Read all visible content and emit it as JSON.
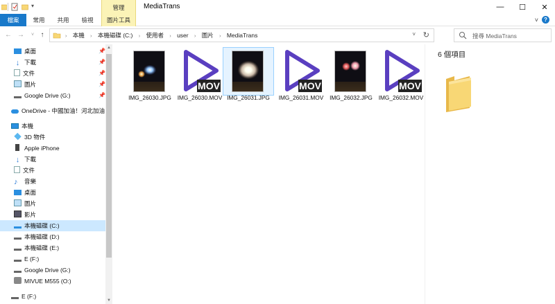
{
  "titlebar": {
    "title": "MediaTrans",
    "context_group": "管理",
    "minimize": "—",
    "maximize": "☐",
    "close": "✕"
  },
  "ribbon": {
    "tabs": [
      "檔案",
      "常用",
      "共用",
      "檢視"
    ],
    "context_tab": "圖片工具",
    "toggle": "˅",
    "help": "?"
  },
  "address": {
    "crumbs": [
      "本機",
      "本機磁碟 (C:)",
      "使用者",
      "user",
      "圖片",
      "MediaTrans"
    ],
    "search_placeholder": "搜尋 MediaTrans"
  },
  "nav": {
    "quick_access": [
      {
        "label": "桌面",
        "icon": "desktop-icon",
        "pinned": true
      },
      {
        "label": "下載",
        "icon": "download-icon",
        "pinned": true
      },
      {
        "label": "文件",
        "icon": "document-icon",
        "pinned": true
      },
      {
        "label": "圖片",
        "icon": "pictures-icon",
        "pinned": true
      },
      {
        "label": "Google Drive (G:)",
        "icon": "drive-icon",
        "pinned": true
      }
    ],
    "onedrive": "OneDrive - 中國加油！河北加油！",
    "this_pc": "本機",
    "pc_items": [
      {
        "label": "3D 物件",
        "icon": "cube-icon"
      },
      {
        "label": "Apple iPhone",
        "icon": "phone-icon"
      },
      {
        "label": "下載",
        "icon": "download-icon"
      },
      {
        "label": "文件",
        "icon": "document-icon"
      },
      {
        "label": "音樂",
        "icon": "music-icon"
      },
      {
        "label": "桌面",
        "icon": "desktop-icon"
      },
      {
        "label": "圖片",
        "icon": "pictures-icon"
      },
      {
        "label": "影片",
        "icon": "video-icon"
      },
      {
        "label": "本機磁碟 (C:)",
        "icon": "drive-icon",
        "selected": true
      },
      {
        "label": "本機磁碟 (D:)",
        "icon": "drive-icon"
      },
      {
        "label": "本機磁碟 (E:)",
        "icon": "drive-icon"
      },
      {
        "label": "E (F:)",
        "icon": "drive-icon"
      },
      {
        "label": "Google Drive (G:)",
        "icon": "drive-icon"
      },
      {
        "label": "MIVUE M555 (O:)",
        "icon": "camera-icon"
      }
    ],
    "bottom_item": "E (F:)"
  },
  "files": [
    {
      "name": "IMG_26030.JPG",
      "type": "jpg"
    },
    {
      "name": "IMG_26030.MOV",
      "type": "mov"
    },
    {
      "name": "IMG_26031.JPG",
      "type": "jpg",
      "selected": true
    },
    {
      "name": "IMG_26031.MOV",
      "type": "mov"
    },
    {
      "name": "IMG_26032.JPG",
      "type": "jpg"
    },
    {
      "name": "IMG_26032.MOV",
      "type": "mov"
    }
  ],
  "mov_badge": "MOV",
  "preview": {
    "count_text": "6 個項目"
  },
  "colors": {
    "accent": "#1979ca",
    "context_tab": "#fbf3b7",
    "mov_purple": "#5a3fc0",
    "selection": "#cce8ff",
    "folder": "#f8d775"
  }
}
